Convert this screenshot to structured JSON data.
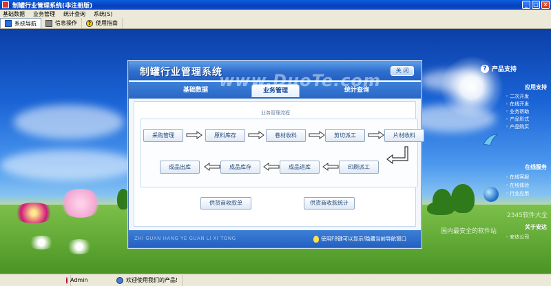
{
  "window": {
    "title": "制罐行业管理系统(非注册版)",
    "controls": [
      "_",
      "□",
      "×"
    ]
  },
  "menu": [
    "基础数据",
    "业务管理",
    "统计查询",
    "系统(S)"
  ],
  "toolbar": [
    {
      "label": "系统导航",
      "icon": "nav-icon"
    },
    {
      "label": "信息操作",
      "icon": "info-icon"
    },
    {
      "label": "使用指南",
      "icon": "help-icon"
    }
  ],
  "dialog": {
    "title": "制罐行业管理系统",
    "close_label": "关 闭",
    "tabs": [
      "基础数据",
      "业务管理",
      "统计查询"
    ],
    "active_tab": "业务管理",
    "flow_title": "业务管理流程",
    "steps_row1": [
      "采购管理",
      "原料库存",
      "卷材收料",
      "剪切派工",
      "片材收料"
    ],
    "steps_row2": [
      "成品出库",
      "成品库存",
      "成品进库",
      "印刷派工"
    ],
    "buttons": [
      "供货商收款单",
      "供货商收款统计"
    ],
    "footer_pinyin": "ZHI GUAN HANG YE GUAN LI XI TONG",
    "footer_hint": "使用F8键可以显示/隐藏当前导航窗口"
  },
  "support": {
    "title": "产品支持",
    "sections": [
      {
        "head": "应用支持",
        "items": [
          "二次开发",
          "在线开发",
          "业务帮助",
          "产品形式",
          "产品购买"
        ]
      },
      {
        "head": "在线服务",
        "items": [
          "在线客服",
          "在线体验",
          "行业应用"
        ]
      },
      {
        "head": "关于安达",
        "items": [
          "安达公司"
        ]
      }
    ]
  },
  "watermark": {
    "main": "www.DuoTe.com",
    "corner1": "2345软件大全",
    "corner2": "国内最安全的软件站"
  },
  "statusbar": {
    "user": "Admin",
    "message": "欢迎使用我们的产品!"
  },
  "colors": {
    "title_blue": "#0a4ad0",
    "dialog_blue": "#2f6ecf",
    "step_text": "#234a7c"
  }
}
